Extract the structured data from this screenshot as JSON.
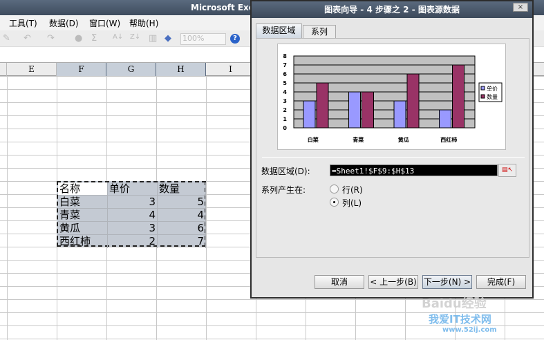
{
  "app": {
    "title": "Microsoft Excel"
  },
  "menu": [
    {
      "label": "工具(T)"
    },
    {
      "label": "数据(D)"
    },
    {
      "label": "窗口(W)"
    },
    {
      "label": "帮助(H)"
    }
  ],
  "toolbar": {
    "zoom": "100%",
    "sigma": "Σ",
    "help": "?"
  },
  "columns": [
    "E",
    "F",
    "G",
    "H",
    "I"
  ],
  "table": {
    "headers": [
      "名称",
      "单价",
      "数量"
    ],
    "rows": [
      [
        "白菜",
        "3",
        "5"
      ],
      [
        "青菜",
        "4",
        "4"
      ],
      [
        "黄瓜",
        "3",
        "6"
      ],
      [
        "西红柿",
        "2",
        "7"
      ]
    ]
  },
  "dialog": {
    "title": "图表向导 - 4 步骤之 2 - 图表源数据",
    "close": "×",
    "tabs": [
      {
        "label": "数据区域"
      },
      {
        "label": "系列"
      }
    ],
    "range_label": "数据区域(D):",
    "range_value": "=Sheet1!$F$9:$H$13",
    "series_label": "系列产生在:",
    "radio_row": "行(R)",
    "radio_col": "列(L)",
    "series_in": "列",
    "buttons": {
      "cancel": "取消",
      "back": "< 上一步(B)",
      "next": "下一步(N) >",
      "finish": "完成(F)"
    }
  },
  "chart_data": {
    "type": "bar",
    "categories": [
      "白菜",
      "青菜",
      "黄瓜",
      "西红柿"
    ],
    "series": [
      {
        "name": "单价",
        "values": [
          3,
          4,
          3,
          2
        ],
        "color": "#9999ff"
      },
      {
        "name": "数量",
        "values": [
          5,
          4,
          6,
          7
        ],
        "color": "#993366"
      }
    ],
    "ylim": [
      0,
      8
    ],
    "yticks": [
      "0",
      "1",
      "2",
      "3",
      "4",
      "5",
      "6",
      "7",
      "8"
    ],
    "legend": "right",
    "grid": true
  },
  "watermark": {
    "line1": "Baidu经验",
    "line2": "我爱IT技术网",
    "line3": "www.52ij.com"
  }
}
